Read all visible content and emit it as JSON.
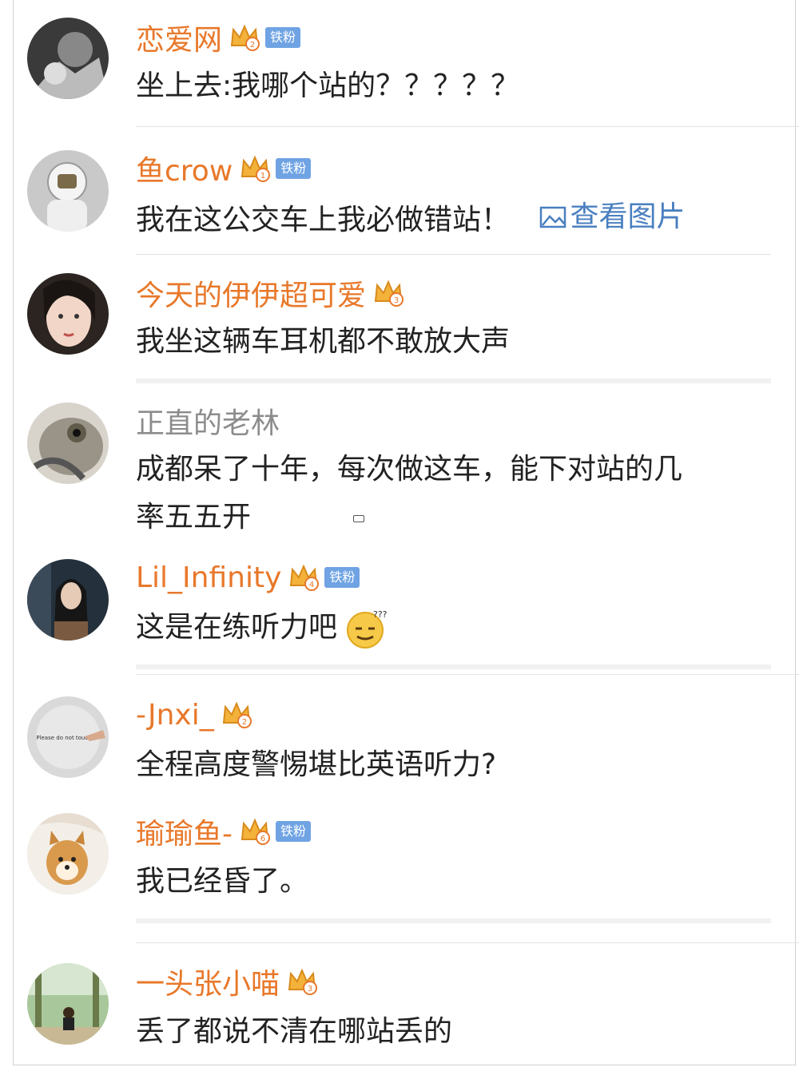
{
  "comments": [
    {
      "user": "恋爱网",
      "level": "2",
      "fan": "铁粉",
      "text": "坐上去:我哪个站的？？？？？"
    },
    {
      "user": "鱼crow",
      "level": "1",
      "fan": "铁粉",
      "text": "我在这公交车上我必做错站！",
      "link": "查看图片"
    },
    {
      "user": "今天的伊伊超可爱",
      "level": "3",
      "text": "我坐这辆车耳机都不敢放大声"
    },
    {
      "user": "正直的老林",
      "text_line1": "成都呆了十年，每次做这车，能下对站的几",
      "text_line2": "率五五开"
    },
    {
      "user": "Lil_Infinity",
      "level": "4",
      "fan": "铁粉",
      "text": "这是在练听力吧"
    },
    {
      "user": "-Jnxi_",
      "level": "2",
      "text": "全程高度警惕堪比英语听力?"
    },
    {
      "user": "瑜瑜鱼-",
      "level": "6",
      "fan": "铁粉",
      "text": "我已经昏了。"
    },
    {
      "user": "一头张小喵",
      "level": "3",
      "text": "丢了都说不清在哪站丢的"
    }
  ],
  "colors": {
    "username": "#e8782a",
    "username_plain": "#8c8c8c",
    "link": "#4a7fc0",
    "fan_badge": "#6fa3e3"
  },
  "avatar_texts": {
    "please_do_not_touch": "Please do not touch"
  }
}
